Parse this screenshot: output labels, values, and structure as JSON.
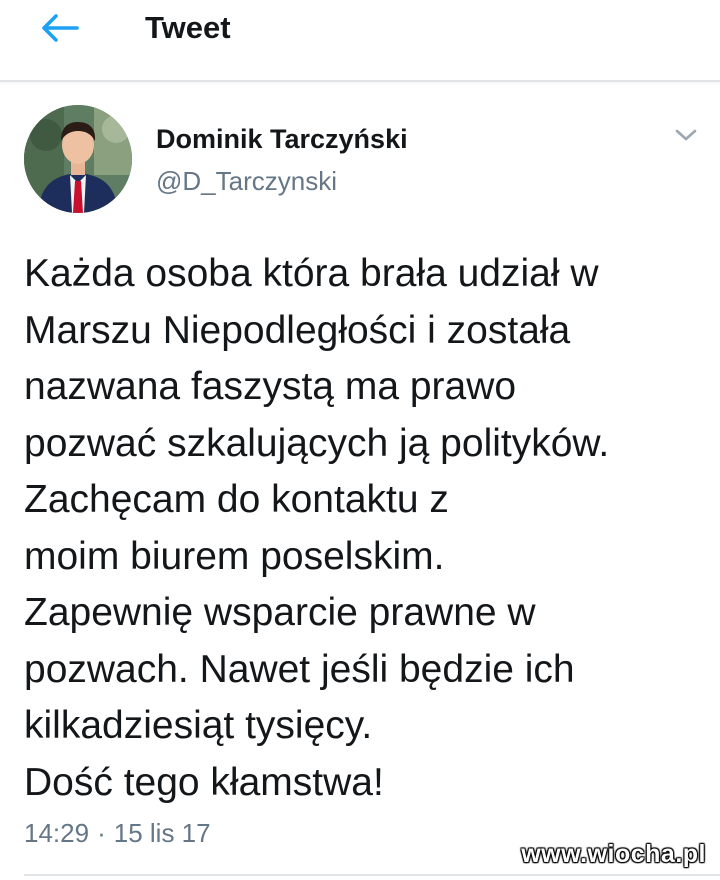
{
  "header": {
    "title": "Tweet",
    "back_icon": "arrow-left-icon",
    "accent_color": "#1da1f2"
  },
  "tweet": {
    "author": {
      "name": "Dominik Tarczyński",
      "handle": "@D_Tarczynski",
      "avatar_icon": "profile-photo"
    },
    "menu_icon": "chevron-down-icon",
    "text_lines": [
      "Każda osoba która brała udział w",
      "Marszu Niepodległości i została",
      "nazwana faszystą ma prawo",
      "pozwać szkalujących ją polityków.",
      "Zachęcam do kontaktu z",
      "moim biurem poselskim.",
      "Zapewnię wsparcie prawne w",
      "pozwach. Nawet jeśli będzie ich",
      "kilkadziesiąt tysięcy.",
      "Dość tego kłamstwa!"
    ],
    "time": "14:29",
    "separator": "·",
    "date": "15 lis 17"
  },
  "watermark": "www.wiocha.pl",
  "colors": {
    "text": "#14171a",
    "secondary_text": "#657786",
    "divider": "#e1e4e6"
  }
}
